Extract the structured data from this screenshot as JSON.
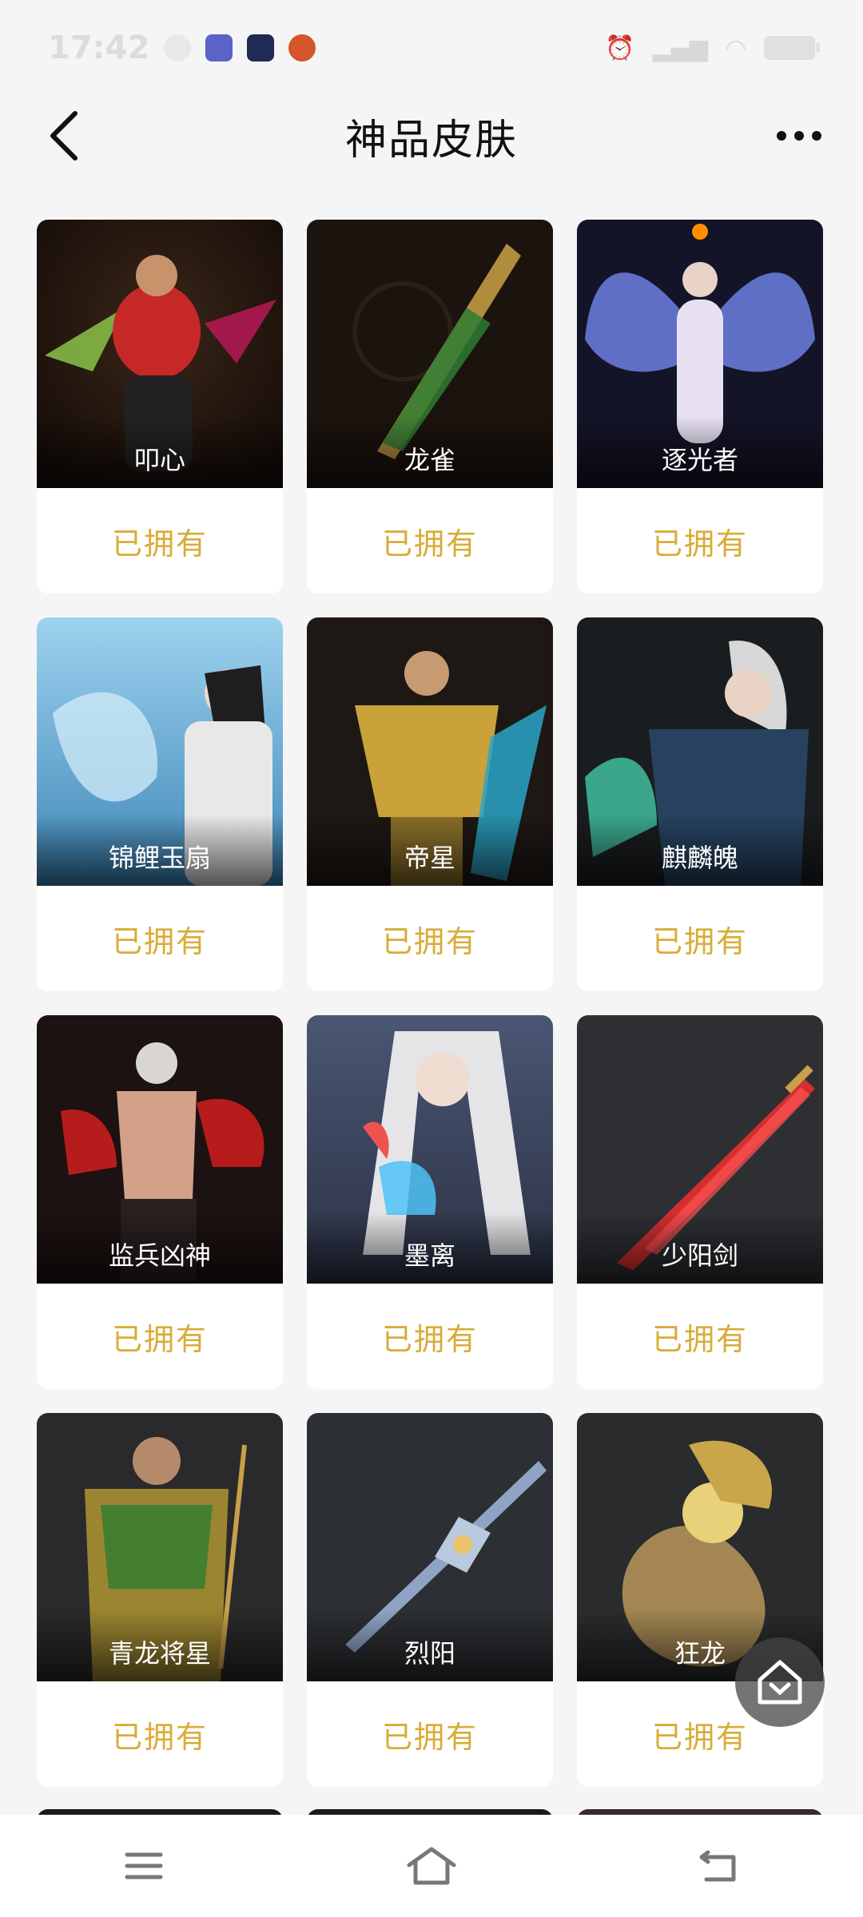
{
  "status_bar": {
    "time": "17:42"
  },
  "header": {
    "title": "神品皮肤"
  },
  "items": [
    {
      "name": "叩心",
      "status": "已拥有"
    },
    {
      "name": "龙雀",
      "status": "已拥有"
    },
    {
      "name": "逐光者",
      "status": "已拥有"
    },
    {
      "name": "锦鲤玉扇",
      "status": "已拥有"
    },
    {
      "name": "帝星",
      "status": "已拥有"
    },
    {
      "name": "麒麟魄",
      "status": "已拥有"
    },
    {
      "name": "监兵凶神",
      "status": "已拥有"
    },
    {
      "name": "墨离",
      "status": "已拥有"
    },
    {
      "name": "少阳剑",
      "status": "已拥有"
    },
    {
      "name": "青龙将星",
      "status": "已拥有"
    },
    {
      "name": "烈阳",
      "status": "已拥有"
    },
    {
      "name": "狂龙",
      "status": "已拥有"
    }
  ],
  "colors": {
    "owned_text": "#d9ac37",
    "background": "#f5f5f5"
  },
  "icons": {
    "back": "back-arrow-icon",
    "more": "more-dots-icon",
    "float": "home-icon",
    "nav": [
      "menu-icon",
      "home-icon",
      "back-icon"
    ]
  }
}
